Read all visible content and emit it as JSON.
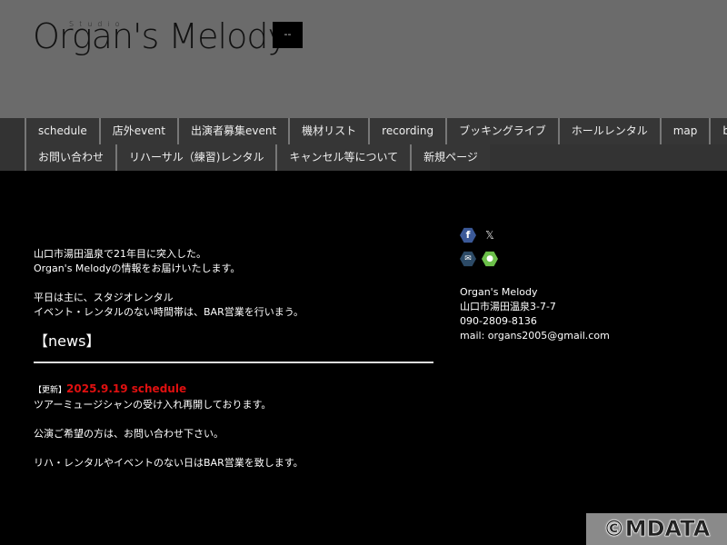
{
  "header": {
    "logo_text": "Organ's Melody",
    "logo_small": "Studio",
    "menu_button": "--"
  },
  "nav": {
    "row1": [
      "schedule",
      "店外event",
      "出演者募集event",
      "機材リスト",
      "recording",
      "ブッキングライブ",
      "ホールレンタル",
      "map",
      "blog"
    ],
    "row2": [
      "お問い合わせ",
      "リハーサル（練習)レンタル",
      "キャンセル等について",
      "新規ページ"
    ]
  },
  "main": {
    "intro1": [
      "山口市湯田温泉で21年目に突入した。",
      "Organ's Melodyの情報をお届けいたします。"
    ],
    "intro2": [
      "平日は主に、スタジオレンタル",
      "イベント・レンタルのない時間帯は、BAR営業を行いまう。"
    ],
    "news_title": "【news】",
    "news": {
      "tag": "【更新】",
      "date": "2025.9.19  schedule",
      "lines": [
        "ツアーミュージシャンの受け入れ再開しております。",
        "公演ご希望の方は、お問い合わせ下さい。",
        "リハ・レンタルやイベントのない日はBAR営業を致します。"
      ]
    },
    "accent_color": "#e01010"
  },
  "side": {
    "icons": [
      "facebook-icon",
      "x-icon",
      "mail-icon",
      "evernote-icon"
    ],
    "name": "Organ's Melody",
    "address": "山口市湯田温泉3-7-7",
    "phone": "090-2809-8136",
    "mail": "mail: organs2005@gmail.com"
  },
  "watermark": "©MDATA"
}
